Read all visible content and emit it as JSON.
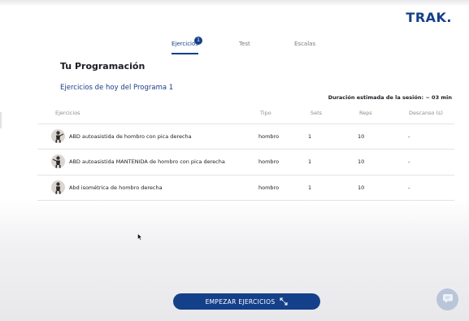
{
  "brand": {
    "logo": "TRAK.",
    "color": "#14408a"
  },
  "tabs": [
    {
      "label": "Ejercicios",
      "active": true,
      "badge": "1"
    },
    {
      "label": "Test",
      "active": false
    },
    {
      "label": "Escalas",
      "active": false
    }
  ],
  "main": {
    "title": "Tu Programación",
    "program_title": "Ejercicios de hoy del Programa 1",
    "duration": "Duración estimada de la sesión: ~ 03 min"
  },
  "table": {
    "headers": [
      "Ejercicios",
      "Tipo",
      "Sets",
      "Reps",
      "Descanso (s)"
    ],
    "rows": [
      {
        "name": "ABD autoasistida de hombro con pica derecha",
        "tipo": "hombro",
        "sets": "1",
        "reps": "10",
        "descanso": "-"
      },
      {
        "name": "ABD autoasistida MANTENIDA de hombro con pica derecha",
        "tipo": "hombro",
        "sets": "1",
        "reps": "10",
        "descanso": "-"
      },
      {
        "name": "Abd isométrica de hombro derecha",
        "tipo": "hombro",
        "sets": "1",
        "reps": "10",
        "descanso": "-"
      }
    ]
  },
  "actions": {
    "start_label": "EMPEZAR EJERCICIOS",
    "start_icon": "expand-icon",
    "chat_icon": "chat-icon"
  }
}
